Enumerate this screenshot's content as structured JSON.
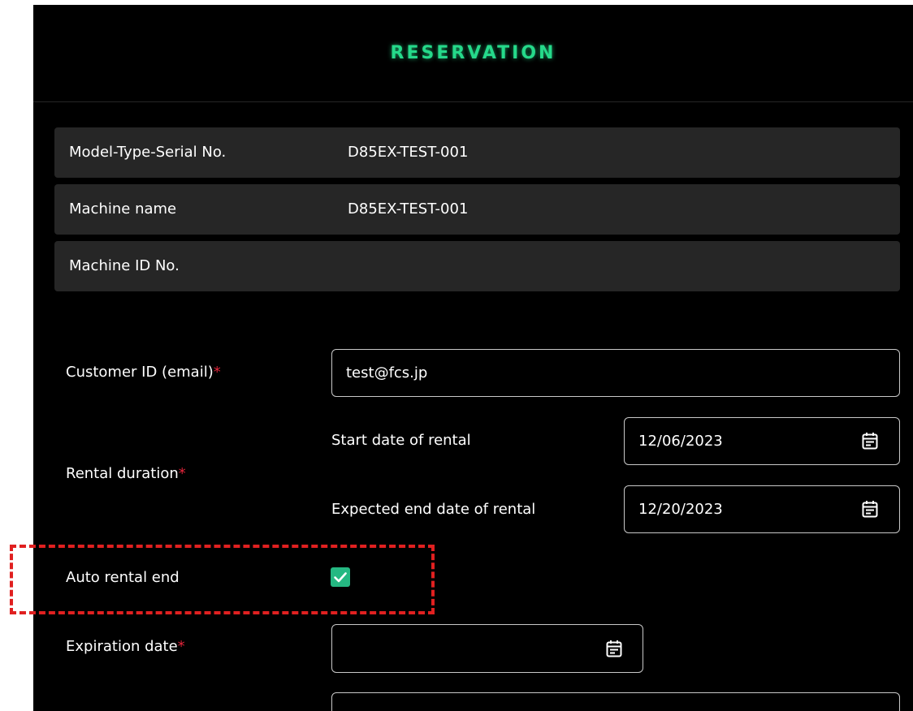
{
  "header": {
    "title": "RESERVATION"
  },
  "machine_info": [
    {
      "label": "Model-Type-Serial No.",
      "value": "D85EX-TEST-001"
    },
    {
      "label": "Machine name",
      "value": "D85EX-TEST-001"
    },
    {
      "label": "Machine ID No.",
      "value": ""
    }
  ],
  "form": {
    "required_mark": "*",
    "customer_id": {
      "label": "Customer ID (email)",
      "value": "test@fcs.jp"
    },
    "rental_duration": {
      "label": "Rental duration",
      "start": {
        "label": "Start date of rental",
        "value": "12/06/2023"
      },
      "end": {
        "label": "Expected end date of rental",
        "value": "12/20/2023"
      }
    },
    "auto_rental_end": {
      "label": "Auto rental end",
      "checked": true
    },
    "expiration_date": {
      "label": "Expiration date",
      "value": ""
    }
  },
  "colors": {
    "accent": "#25d98a",
    "checkbox": "#25b882",
    "required": "#e0243a",
    "panel_bg": "#000000",
    "row_bg": "#262626",
    "highlight": "#e02020"
  },
  "icons": {
    "date_picker": "calendar-icon",
    "checkbox_mark": "checkmark-icon"
  }
}
